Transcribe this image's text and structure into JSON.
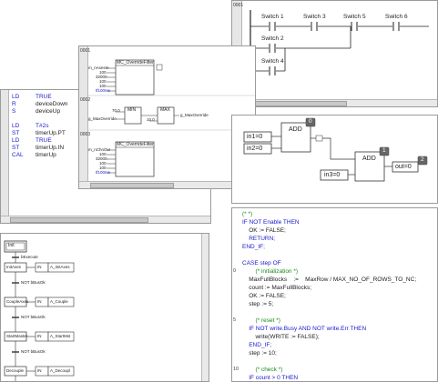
{
  "ladder": {
    "network": "0001",
    "rung1": [
      "Switch 1",
      "Switch 3",
      "Switch 5",
      "Switch 6"
    ],
    "rung2": "Switch 2",
    "rung3": "Switch 4"
  },
  "fbd_top": {
    "networks": [
      "0001",
      "0002",
      "0003"
    ],
    "block1": {
      "name": "MC_OverrideFilter",
      "inputs": [
        "m_nAxesIn",
        "100",
        "32000",
        "100",
        "100",
        "tf100ms"
      ]
    },
    "block2": {
      "min": "MIN",
      "max": "MAX",
      "const1": "70.0",
      "const2": "10.0",
      "input": "g_MaxOverride",
      "output": "g_MaxOverride"
    },
    "block3": {
      "name": "MC_OverrideFilter",
      "inputs": [
        "m_nChnOvr",
        "100",
        "32000",
        "100",
        "100",
        "tf100ms"
      ]
    }
  },
  "il": {
    "rows": [
      {
        "op": "LD",
        "arg": "TRUE"
      },
      {
        "op": "R",
        "arg": "deviceDown"
      },
      {
        "op": "S",
        "arg": "deviceUp"
      },
      {
        "op": "",
        "arg": ""
      },
      {
        "op": "LD",
        "arg": "T#2s"
      },
      {
        "op": "ST",
        "arg": "timerUp.PT"
      },
      {
        "op": "LD",
        "arg": "TRUE"
      },
      {
        "op": "ST",
        "arg": "timerUp.IN"
      },
      {
        "op": "CAL",
        "arg": "timerUp"
      }
    ]
  },
  "cfc": {
    "add1": "ADD",
    "add2": "ADD",
    "in1": "in1=0",
    "in2": "in2=0",
    "in3": "in3=0",
    "out": "out=0",
    "order0": "0",
    "order1": "1",
    "order2": "2"
  },
  "sfc": {
    "init": "Init",
    "init_action": "bExecute",
    "steps": [
      {
        "name": "InitAxes",
        "action1": "IN",
        "action2": "A_InitAxes",
        "transition": "NOT bBusOk"
      },
      {
        "name": "CoupleAxes",
        "action1": "IN",
        "action2": "A_Couple",
        "transition": "NOT bBusOk"
      },
      {
        "name": "StartMaster",
        "action1": "IN",
        "action2": "A_StartMst",
        "transition": "NOT bBusOk"
      },
      {
        "name": "Decouple",
        "action1": "IN",
        "action2": "A_Decoupl",
        "transition": ""
      }
    ]
  },
  "st": {
    "lines": [
      {
        "n": "",
        "t": "(* *)",
        "c": "cm"
      },
      {
        "n": "",
        "t": "IF NOT Enable THEN",
        "c": "kw"
      },
      {
        "n": "",
        "t": "    OK := FALSE;",
        "c": ""
      },
      {
        "n": "",
        "t": "    RETURN;",
        "c": "kw"
      },
      {
        "n": "",
        "t": "END_IF;",
        "c": "kw"
      },
      {
        "n": "",
        "t": "",
        "c": ""
      },
      {
        "n": "",
        "t": "CASE step OF",
        "c": "kw"
      },
      {
        "n": "0",
        "t": "        (* initialization *)",
        "c": "cm"
      },
      {
        "n": "",
        "t": "    MaxFullBlocks    :=    MaxRow / MAX_NO_OF_ROWS_TO_NC;",
        "c": ""
      },
      {
        "n": "",
        "t": "    count := MaxFullBlocks;",
        "c": ""
      },
      {
        "n": "",
        "t": "    OK := FALSE;",
        "c": ""
      },
      {
        "n": "",
        "t": "    step := 5;",
        "c": ""
      },
      {
        "n": "",
        "t": "",
        "c": ""
      },
      {
        "n": "5",
        "t": "        (* reset *)",
        "c": "cm"
      },
      {
        "n": "",
        "t": "    IF NOT write.Busy AND NOT write.Err THEN",
        "c": "kw"
      },
      {
        "n": "",
        "t": "        write(WRITE := FALSE);",
        "c": ""
      },
      {
        "n": "",
        "t": "    END_IF;",
        "c": "kw"
      },
      {
        "n": "",
        "t": "    step := 10;",
        "c": ""
      },
      {
        "n": "",
        "t": "",
        "c": ""
      },
      {
        "n": "10",
        "t": "        (* check *)",
        "c": "cm"
      },
      {
        "n": "",
        "t": "    IF count > 0 THEN",
        "c": "kw"
      }
    ]
  },
  "colors": {
    "keyword": "#1a1acc",
    "comment": "#1a8a1a",
    "order_badge": "#666666",
    "frame": "#9a9a9a"
  }
}
